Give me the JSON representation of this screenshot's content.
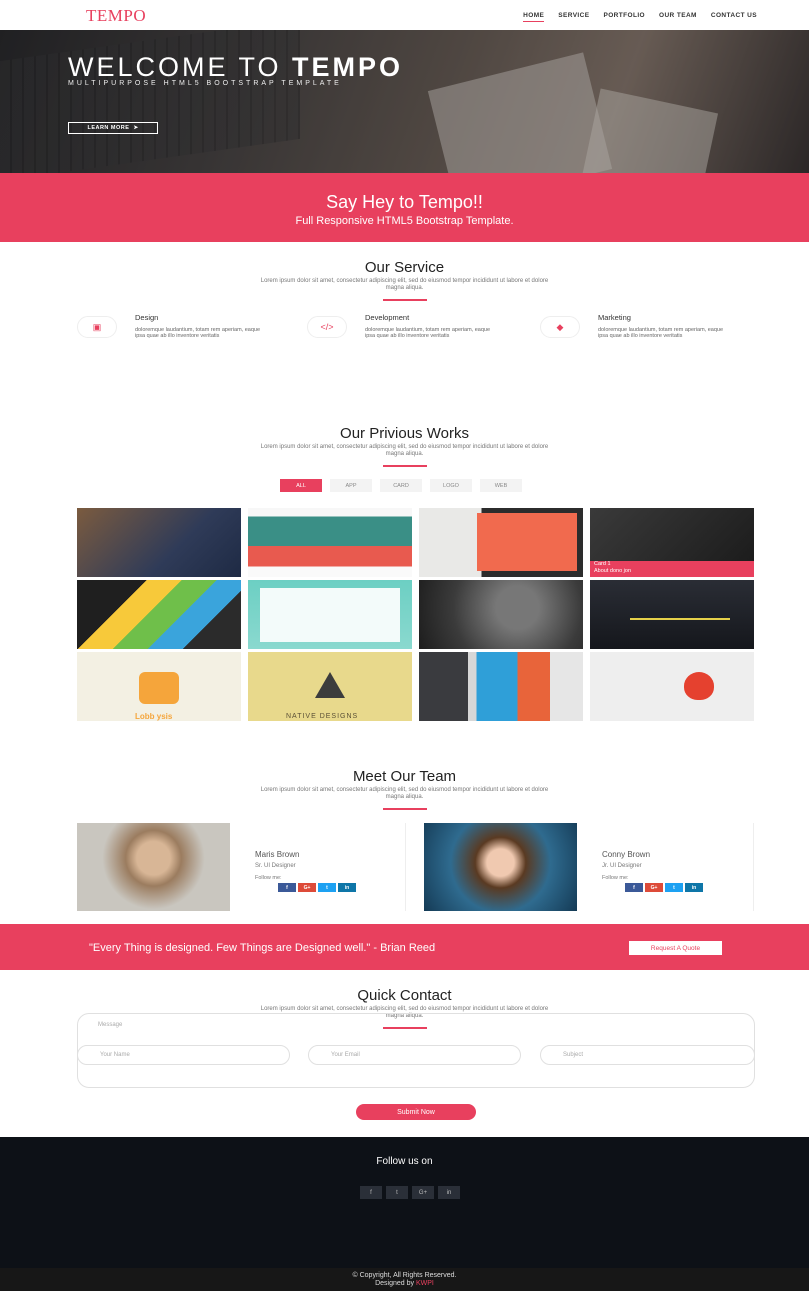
{
  "nav": {
    "brand": "TEMPO",
    "items": [
      "HOME",
      "SERVICE",
      "PORTFOLIO",
      "OUR TEAM",
      "CONTACT US"
    ]
  },
  "hero": {
    "title_light": "WELCOME TO ",
    "title_bold": "TEMPO",
    "subtitle": "MULTIPURPOSE HTML5 BOOTSTRAP TEMPLATE",
    "button": "LEARN MORE"
  },
  "banner": {
    "title": "Say Hey to Tempo!!",
    "subtitle": "Full Responsive HTML5 Bootstrap Template."
  },
  "service": {
    "title": "Our Service",
    "lead": "Lorem ipsum dolor sit amet, consectetur adipiscing elit, sed do eiusmod tempor incididunt ut labore et dolore magna aliqua.",
    "items": [
      {
        "title": "Design",
        "icon": "image-icon",
        "text": "doloremque laudantium, totam rem aperiam, eaque ipsa quae ab illo inventore veritatis"
      },
      {
        "title": "Development",
        "icon": "code-icon",
        "text": "doloremque laudantium, totam rem aperiam, eaque ipsa quae ab illo inventore veritatis"
      },
      {
        "title": "Marketing",
        "icon": "diamond-icon",
        "text": "doloremque laudantium, totam rem aperiam, eaque ipsa quae ab illo inventore veritatis"
      }
    ]
  },
  "works": {
    "title": "Our Privious Works",
    "lead": "Lorem ipsum dolor sit amet, consectetur adipiscing elit, sed do eiusmod tempor incididunt ut labore et dolore magna aliqua.",
    "filters": [
      "ALL",
      "APP",
      "CARD",
      "LOGO",
      "WEB"
    ],
    "card_caption": "Card 1",
    "card_sub": "About dono jon",
    "tile9_text": "Lobb ysis",
    "tile10_text": "NATIVE DESIGNS"
  },
  "team": {
    "title": "Meet Our Team",
    "lead": "Lorem ipsum dolor sit amet, consectetur adipiscing elit, sed do eiusmod tempor incididunt ut labore et dolore magna aliqua.",
    "members": [
      {
        "name": "Maris Brown",
        "role": "Sr. UI Designer",
        "follow": "Follow me:"
      },
      {
        "name": "Conny Brown",
        "role": "Jr. UI Designer",
        "follow": "Follow me:"
      }
    ],
    "social": [
      "f",
      "G+",
      "t",
      "in"
    ]
  },
  "quote": {
    "text": "\"Every Thing is designed. Few Things are Designed well.\" - Brian Reed",
    "button": "Request A Quote"
  },
  "contact": {
    "title": "Quick Contact",
    "lead": "Lorem ipsum dolor sit amet, consectetur adipiscing elit, sed do eiusmod tempor incididunt ut labore et dolore magna aliqua.",
    "name_ph": "Your Name",
    "email_ph": "Your Email",
    "subject_ph": "Subject",
    "message_ph": "Message",
    "submit": "Submit Now"
  },
  "footer": {
    "follow": "Follow us on",
    "social": [
      "f",
      "t",
      "G+",
      "in"
    ],
    "copyright": "© Copyright, All Rights Reserved.",
    "designed_by": "Designed by",
    "designer": "KWPI"
  },
  "colors": {
    "accent": "#e8405e",
    "footer": "#0d1117"
  }
}
